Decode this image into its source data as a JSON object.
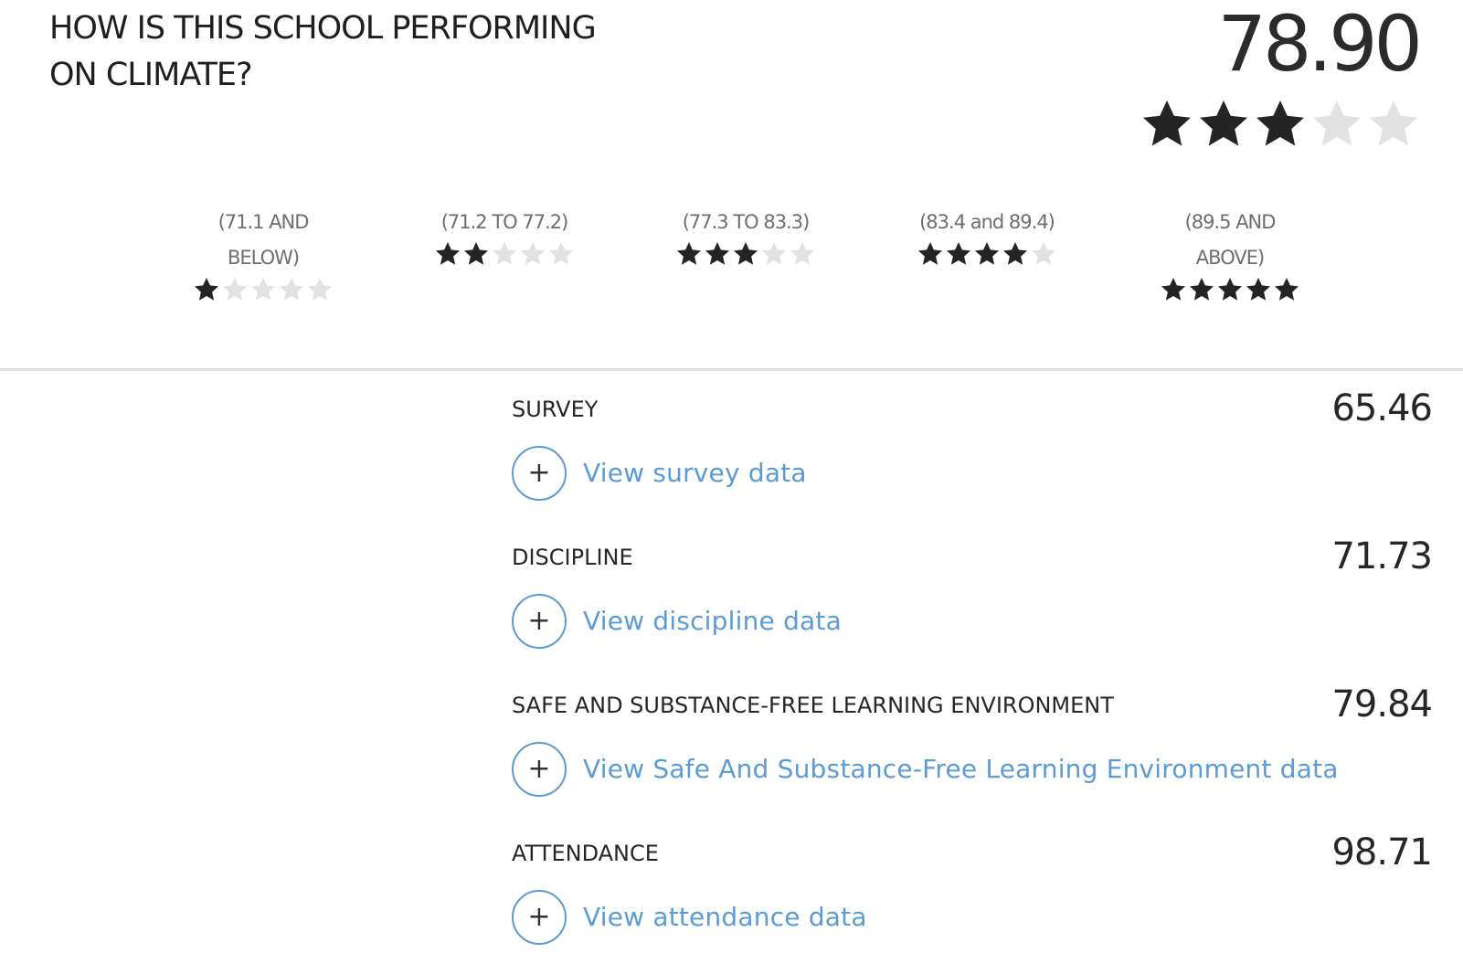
{
  "header": {
    "title": "HOW IS THIS SCHOOL PERFORMING ON CLIMATE?",
    "overall_score": "78.90",
    "overall_stars": 3,
    "max_stars": 5
  },
  "legend": [
    {
      "range": "(71.1 AND BELOW)",
      "stars": 1
    },
    {
      "range": "(71.2 TO 77.2)",
      "stars": 2
    },
    {
      "range": "(77.3 TO 83.3)",
      "stars": 3
    },
    {
      "range": "(83.4 and 89.4)",
      "stars": 4
    },
    {
      "range": "(89.5 AND ABOVE)",
      "stars": 5
    }
  ],
  "metrics": [
    {
      "title": "SURVEY",
      "score": "65.46",
      "link_label": "View survey data",
      "button_glyph": "+"
    },
    {
      "title": "DISCIPLINE",
      "score": "71.73",
      "link_label": "View discipline data",
      "button_glyph": "+"
    },
    {
      "title": "SAFE AND SUBSTANCE-FREE LEARNING ENVIRONMENT",
      "score": "79.84",
      "link_label": "View Safe And Substance-Free Learning Environment data",
      "button_glyph": "+"
    },
    {
      "title": "ATTENDANCE",
      "score": "98.71",
      "link_label": "View attendance data",
      "button_glyph": "+"
    }
  ],
  "colors": {
    "star_filled": "#242424",
    "star_empty": "#e2e2e2",
    "link": "#5a9bd8",
    "button_border": "#5b9ad6"
  },
  "icons": {
    "star": "star-icon",
    "expand": "plus-icon"
  }
}
